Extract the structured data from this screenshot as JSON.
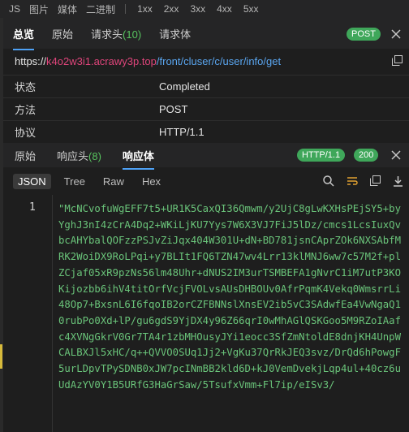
{
  "filter_bar": {
    "items": [
      "JS",
      "图片",
      "媒体",
      "二进制"
    ],
    "status_filters": [
      "1xx",
      "2xx",
      "3xx",
      "4xx",
      "5xx"
    ]
  },
  "request_tabs": {
    "overview": "总览",
    "raw": "原始",
    "headers_label": "请求头",
    "headers_count": "(10)",
    "body": "请求体"
  },
  "method_badge": "POST",
  "url": {
    "scheme": "https://",
    "host": "k4o2w3i1.acrawy3p.top",
    "path": "/front/cluser/c/user/info/get"
  },
  "info_rows": [
    {
      "key": "状态",
      "value": "Completed"
    },
    {
      "key": "方法",
      "value": "POST"
    },
    {
      "key": "协议",
      "value": "HTTP/1.1"
    }
  ],
  "response_tabs": {
    "raw": "原始",
    "headers_label": "响应头",
    "headers_count": "(8)",
    "body": "响应体"
  },
  "protocol_badge": "HTTP/1.1",
  "status_badge": "200",
  "formats": [
    "JSON",
    "Tree",
    "Raw",
    "Hex"
  ],
  "editor": {
    "line_number": "1",
    "content": "\"McNCvofuWgEFF7t5+UR1K5CaxQI36Qmwm/y2UjC8gLwKXHsPEjSY5+byYghJ3nI4zCrA4Dq2+WKiLjKU7Yys7W6X3VJ7FiJ5lDz/cmcs1LcsIuxQvbcAHYbalQOFzzPSJvZiJqx404W301U+dN+BD781jsnCAprZOk6NXSAbfMRK2WoiDX9RoLPqi+y7BLIt1FQ6TZN47wv4Lrr13klMNJ6ww7c57M2f+plZCjaf05xR9pzNs56lm48Uhr+dNUS2IM3urTSMBEFA1gNvrC1iM7utP3KOKijozbb6ihV4titOrfVcjFVOLvsAUsDHBOUv0AfrPqmK4Vekq0WmsrrLi48Op7+BxsnL6I6fqoIB2orCZFBNNslXnsEV2ib5vC3SAdwfEa4VwNgaQ10rubPo0Xd+lP/gu6gdS9YjDX4y96Z66qrI0wMhAGlQSKGoo5M9RZoIAafc4XVNgGkrV0Gr7TA4r1zbMHOusyJYi1eocc3SfZmNtoldE8dnjKH4UnpWCALBXJl5xHC/q++QVVO0SUq1Jj2+VgKu37QrRkJEQ3svz/DrQd6hPowgF5urLDpvTPySDNB0xJW7pcINmBB2kld6D+kJ0VemDvekjLqp4ul+40cz6uUdAzYV0Y1B5URfG3HaGrSaw/5TsufxVmm+Fl7ip/eISv3/"
  }
}
